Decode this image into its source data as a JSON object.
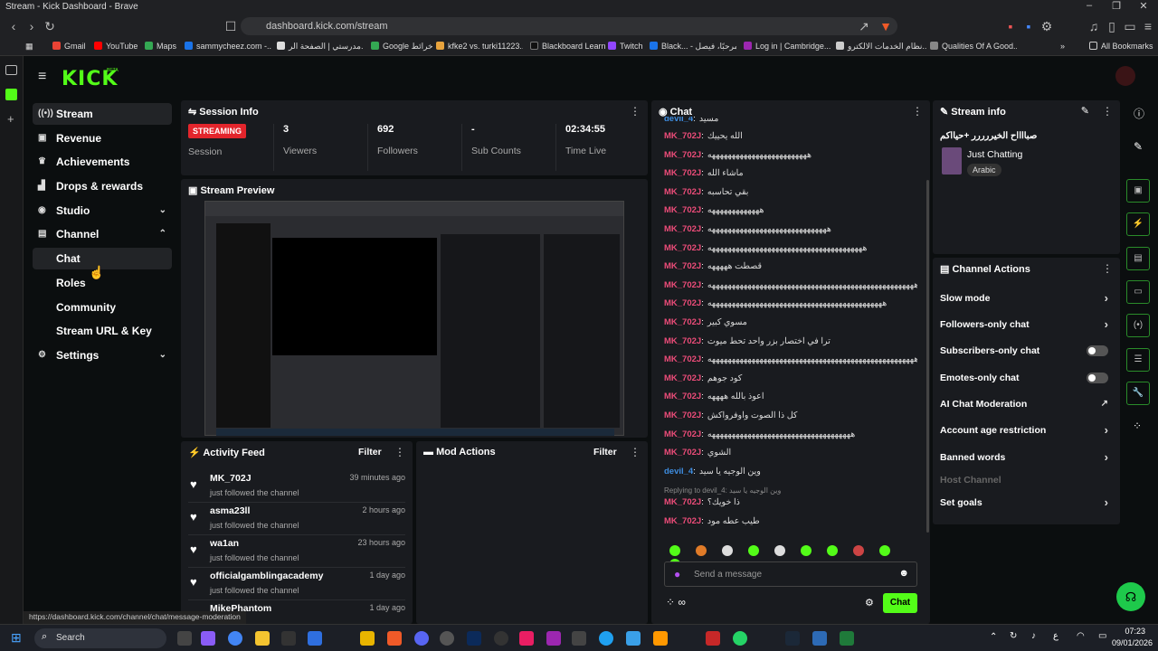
{
  "browser": {
    "tab_title": "Stream - Kick Dashboard - Brave",
    "url": "dashboard.kick.com/stream",
    "bookmarks": [
      "Gmail",
      "YouTube",
      "Maps",
      "sammycheez.com -...",
      "مدرستي | الصفحة الر...",
      "Google خرائط",
      "kfke2 vs. turki11223...",
      "Blackboard Learn",
      "Twitch",
      "Black... - مرحبًا، فيصل",
      "Log in | Cambridge...",
      "نظام الخدمات الالكترو...",
      "Qualities Of A Good...",
      "All Bookmarks"
    ]
  },
  "brand": {
    "logo": "KICK",
    "beta": "BETA"
  },
  "sidebar": {
    "items": [
      {
        "label": "Stream",
        "icon": "broadcast-icon"
      },
      {
        "label": "Revenue",
        "icon": "revenue-icon"
      },
      {
        "label": "Achievements",
        "icon": "trophy-icon"
      },
      {
        "label": "Drops & rewards",
        "icon": "drops-icon"
      },
      {
        "label": "Studio",
        "icon": "studio-icon"
      },
      {
        "label": "Channel",
        "icon": "channel-icon"
      },
      {
        "label": "Chat"
      },
      {
        "label": "Roles"
      },
      {
        "label": "Community"
      },
      {
        "label": "Stream URL & Key"
      },
      {
        "label": "Settings",
        "icon": "gear-icon"
      }
    ]
  },
  "session": {
    "title": "Session Info",
    "status": "STREAMING",
    "status_label": "Session",
    "stats": [
      {
        "value": "3",
        "label": "Viewers"
      },
      {
        "value": "692",
        "label": "Followers"
      },
      {
        "value": "-",
        "label": "Sub Counts"
      },
      {
        "value": "02:34:55",
        "label": "Time Live"
      }
    ]
  },
  "preview": {
    "title": "Stream Preview"
  },
  "activity": {
    "title": "Activity Feed",
    "filter": "Filter",
    "items": [
      {
        "name": "MK_702J",
        "action": "just followed the channel",
        "time": "39 minutes ago"
      },
      {
        "name": "asma23ll",
        "action": "just followed the channel",
        "time": "2 hours ago"
      },
      {
        "name": "wa1an",
        "action": "just followed the channel",
        "time": "23 hours ago"
      },
      {
        "name": "officialgamblingacademy",
        "action": "just followed the channel",
        "time": "1 day ago"
      },
      {
        "name": "MikePhantom",
        "action": "",
        "time": "1 day ago"
      }
    ]
  },
  "mod": {
    "title": "Mod Actions",
    "filter": "Filter"
  },
  "chat": {
    "title": "Chat",
    "placeholder": "Send a message",
    "send": "Chat",
    "messages": [
      {
        "u": "devil_4",
        "t": "مسيد"
      },
      {
        "u": "MK_702J",
        "t": "الله يحييك"
      },
      {
        "u": "MK_702J",
        "t": "هههههههههههههههههههههههههه"
      },
      {
        "u": "MK_702J",
        "t": "ماشاء الله"
      },
      {
        "u": "MK_702J",
        "t": "بقي تحاسبه"
      },
      {
        "u": "MK_702J",
        "t": "هههههههههههههه"
      },
      {
        "u": "MK_702J",
        "t": "ههههههههههههههههههههههههههههههه"
      },
      {
        "u": "MK_702J",
        "t": "هههههههههههههههههههههههههههههههههههههههه"
      },
      {
        "u": "MK_702J",
        "t": "قصطت هههههه"
      },
      {
        "u": "MK_702J",
        "t": "ههههههههههههههههههههههههههههههههههههههههههههههههههههه"
      },
      {
        "u": "MK_702J",
        "t": "ههههههههههههههههههههههههههههههههههههههههههههه"
      },
      {
        "u": "MK_702J",
        "t": "مسوي كبير"
      },
      {
        "u": "MK_702J",
        "t": "ترا في اختصار بزر واحد تحط ميوت"
      },
      {
        "u": "MK_702J",
        "t": "ههههههههههههههههههههههههههههههههههههههههههههههههههههه"
      },
      {
        "u": "MK_702J",
        "t": "كود جوهم"
      },
      {
        "u": "MK_702J",
        "t": "اعوذ بالله ههههه"
      },
      {
        "u": "MK_702J",
        "t": "كل ذا الصوت واوفرواكش"
      },
      {
        "u": "MK_702J",
        "t": "ههههههههههههههههههههههههههههههههههههه"
      },
      {
        "u": "MK_702J",
        "t": "الشوي"
      },
      {
        "u": "devil_4",
        "t": "وين الوجيه يا سيد"
      },
      {
        "u": "MK_702J",
        "t": "ذا خويك؟"
      },
      {
        "u": "MK_702J",
        "t": "طيب عطه مود"
      }
    ],
    "reply": "Replying to devil_4: وين الوجيه يا سيد"
  },
  "stream_info": {
    "title": "Stream info",
    "stream_title": "صبااااح الخيررررر +حيااكم",
    "category": "Just Chatting",
    "tag": "Arabic"
  },
  "channel_actions": {
    "title": "Channel Actions",
    "items": [
      {
        "label": "Slow mode",
        "kind": "chevron"
      },
      {
        "label": "Followers-only chat",
        "kind": "chevron"
      },
      {
        "label": "Subscribers-only chat",
        "kind": "toggle"
      },
      {
        "label": "Emotes-only chat",
        "kind": "toggle"
      },
      {
        "label": "AI Chat Moderation",
        "kind": "external"
      },
      {
        "label": "Account age restriction",
        "kind": "chevron"
      },
      {
        "label": "Banned words",
        "kind": "chevron"
      },
      {
        "label": "Host Channel",
        "kind": "disabled"
      },
      {
        "label": "Set goals",
        "kind": "chevron"
      }
    ]
  },
  "status_url": "https://dashboard.kick.com/channel/chat/message-moderation",
  "taskbar": {
    "search": "Search",
    "time": "07:23",
    "date": "09/01/2026",
    "lang": "ع"
  }
}
